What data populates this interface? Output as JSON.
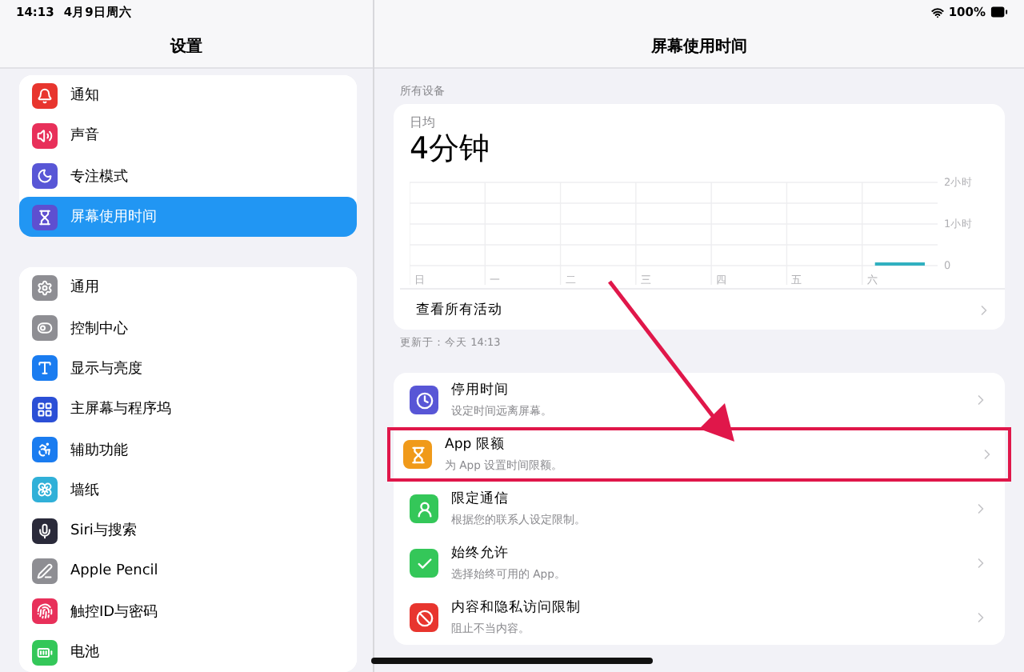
{
  "status_bar": {
    "time": "14:13",
    "date": "4月9日周六",
    "battery": "100%"
  },
  "sidebar": {
    "title": "设置",
    "groups": [
      [
        {
          "label": "通知",
          "color": "#e8352e",
          "selected": false
        },
        {
          "label": "声音",
          "color": "#e8305a",
          "selected": false
        },
        {
          "label": "专注模式",
          "color": "#5856d6",
          "selected": false
        },
        {
          "label": "屏幕使用时间",
          "color": "#5e4fd0",
          "selected": true
        }
      ],
      [
        {
          "label": "通用",
          "color": "#8e8e93",
          "selected": false
        },
        {
          "label": "控制中心",
          "color": "#8e8e93",
          "selected": false
        },
        {
          "label": "显示与亮度",
          "color": "#1a7cf0",
          "selected": false
        },
        {
          "label": "主屏幕与程序坞",
          "color": "#2b4fd6",
          "selected": false
        },
        {
          "label": "辅助功能",
          "color": "#1a7cf0",
          "selected": false
        },
        {
          "label": "墙纸",
          "color": "#30b0d8",
          "selected": false
        },
        {
          "label": "Siri与搜索",
          "color": "#2a2a3a",
          "selected": false
        },
        {
          "label": "Apple Pencil",
          "color": "#8e8e93",
          "selected": false
        },
        {
          "label": "触控ID与密码",
          "color": "#e8305a",
          "selected": false
        },
        {
          "label": "电池",
          "color": "#34c759",
          "selected": false
        }
      ]
    ]
  },
  "detail": {
    "title": "屏幕使用时间",
    "section_label": "所有设备",
    "summary": {
      "label": "日均",
      "value": "4分钟",
      "chart_data": {
        "type": "bar",
        "categories": [
          "日",
          "一",
          "二",
          "三",
          "四",
          "五",
          "六"
        ],
        "values": [
          0,
          0,
          0,
          0,
          0,
          0,
          0.07
        ],
        "ylim": [
          0,
          2
        ],
        "yticks": [
          {
            "value": 0,
            "label": "0"
          },
          {
            "value": 1,
            "label": "1小时"
          },
          {
            "value": 2,
            "label": "2小时"
          }
        ]
      },
      "link": "查看所有活动"
    },
    "updated": "更新于：今天 14:13",
    "rows": [
      {
        "title": "停用时间",
        "subtitle": "设定时间远离屏幕。",
        "color": "#5856d6",
        "highlighted": false
      },
      {
        "title": "App 限额",
        "subtitle": "为 App 设置时间限额。",
        "color": "#f09a1a",
        "highlighted": true
      },
      {
        "title": "限定通信",
        "subtitle": "根据您的联系人设定限制。",
        "color": "#34c759",
        "highlighted": false
      },
      {
        "title": "始终允许",
        "subtitle": "选择始终可用的 App。",
        "color": "#34c759",
        "highlighted": false
      },
      {
        "title": "内容和隐私访问限制",
        "subtitle": "阻止不当内容。",
        "color": "#e8352e",
        "highlighted": false
      }
    ]
  }
}
